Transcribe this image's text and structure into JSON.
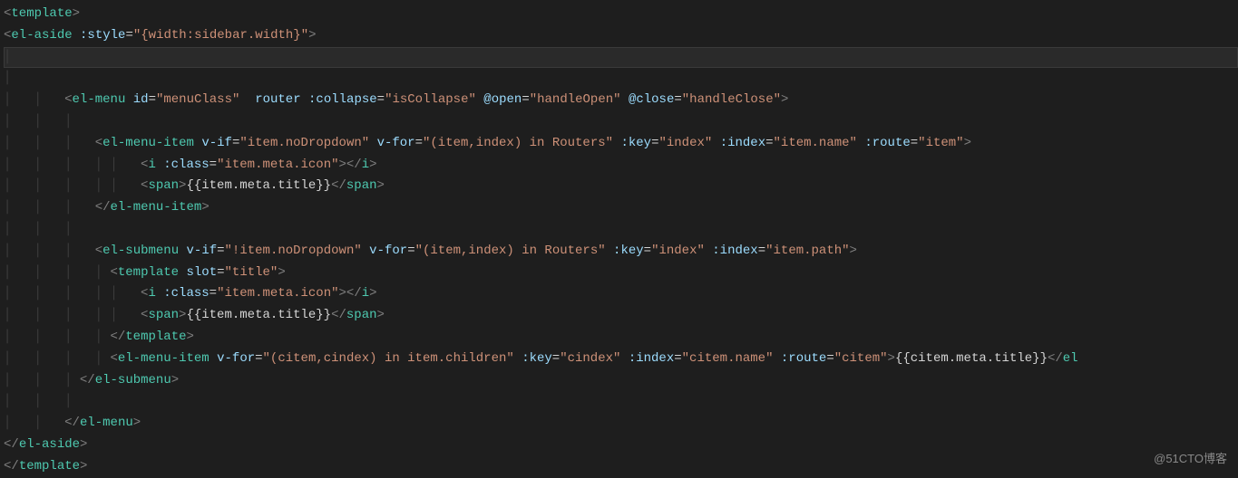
{
  "watermark": "@51CTO博客",
  "code": {
    "lines": [
      {
        "indent": 0,
        "guides": [],
        "tokens": [
          {
            "c": "brk",
            "t": "<"
          },
          {
            "c": "tag",
            "t": "template"
          },
          {
            "c": "brk",
            "t": ">"
          }
        ]
      },
      {
        "indent": 0,
        "guides": [],
        "tokens": [
          {
            "c": "brk",
            "t": "<"
          },
          {
            "c": "tag",
            "t": "el-aside"
          },
          {
            "c": "txt",
            "t": " "
          },
          {
            "c": "attr",
            "t": ":style"
          },
          {
            "c": "txt",
            "t": "="
          },
          {
            "c": "str",
            "t": "\"{width:sidebar.width}\""
          },
          {
            "c": "brk",
            "t": ">"
          }
        ]
      },
      {
        "indent": 0,
        "guides": [
          0
        ],
        "caret": true,
        "tokens": []
      },
      {
        "indent": 0,
        "guides": [
          0
        ],
        "tokens": []
      },
      {
        "indent": 8,
        "guides": [
          0,
          4
        ],
        "tokens": [
          {
            "c": "brk",
            "t": "<"
          },
          {
            "c": "tag",
            "t": "el-menu"
          },
          {
            "c": "txt",
            "t": " "
          },
          {
            "c": "attr",
            "t": "id"
          },
          {
            "c": "txt",
            "t": "="
          },
          {
            "c": "str",
            "t": "\"menuClass\""
          },
          {
            "c": "txt",
            "t": "  "
          },
          {
            "c": "attr",
            "t": "router"
          },
          {
            "c": "txt",
            "t": " "
          },
          {
            "c": "attr",
            "t": ":collapse"
          },
          {
            "c": "txt",
            "t": "="
          },
          {
            "c": "str",
            "t": "\"isCollapse\""
          },
          {
            "c": "txt",
            "t": " "
          },
          {
            "c": "attr",
            "t": "@open"
          },
          {
            "c": "txt",
            "t": "="
          },
          {
            "c": "str",
            "t": "\"handleOpen\""
          },
          {
            "c": "txt",
            "t": " "
          },
          {
            "c": "attr",
            "t": "@close"
          },
          {
            "c": "txt",
            "t": "="
          },
          {
            "c": "str",
            "t": "\"handleClose\""
          },
          {
            "c": "brk",
            "t": ">"
          }
        ]
      },
      {
        "indent": 0,
        "guides": [
          0,
          4,
          8
        ],
        "tokens": []
      },
      {
        "indent": 12,
        "guides": [
          0,
          4,
          8
        ],
        "tokens": [
          {
            "c": "brk",
            "t": "<"
          },
          {
            "c": "tag",
            "t": "el-menu-item"
          },
          {
            "c": "txt",
            "t": " "
          },
          {
            "c": "attr",
            "t": "v-if"
          },
          {
            "c": "txt",
            "t": "="
          },
          {
            "c": "str",
            "t": "\"item.noDropdown\""
          },
          {
            "c": "txt",
            "t": " "
          },
          {
            "c": "attr",
            "t": "v-for"
          },
          {
            "c": "txt",
            "t": "="
          },
          {
            "c": "str",
            "t": "\"(item,index) in Routers\""
          },
          {
            "c": "txt",
            "t": " "
          },
          {
            "c": "attr",
            "t": ":key"
          },
          {
            "c": "txt",
            "t": "="
          },
          {
            "c": "str",
            "t": "\"index\""
          },
          {
            "c": "txt",
            "t": " "
          },
          {
            "c": "attr",
            "t": ":index"
          },
          {
            "c": "txt",
            "t": "="
          },
          {
            "c": "str",
            "t": "\"item.name\""
          },
          {
            "c": "txt",
            "t": " "
          },
          {
            "c": "attr",
            "t": ":route"
          },
          {
            "c": "txt",
            "t": "="
          },
          {
            "c": "str",
            "t": "\"item\""
          },
          {
            "c": "brk",
            "t": ">"
          }
        ]
      },
      {
        "indent": 18,
        "guides": [
          0,
          4,
          8,
          12,
          14
        ],
        "tokens": [
          {
            "c": "brk",
            "t": "<"
          },
          {
            "c": "tag",
            "t": "i"
          },
          {
            "c": "txt",
            "t": " "
          },
          {
            "c": "attr",
            "t": ":class"
          },
          {
            "c": "txt",
            "t": "="
          },
          {
            "c": "str",
            "t": "\"item.meta.icon\""
          },
          {
            "c": "brk",
            "t": "></"
          },
          {
            "c": "tag",
            "t": "i"
          },
          {
            "c": "brk",
            "t": ">"
          }
        ]
      },
      {
        "indent": 18,
        "guides": [
          0,
          4,
          8,
          12,
          14
        ],
        "tokens": [
          {
            "c": "brk",
            "t": "<"
          },
          {
            "c": "tag",
            "t": "span"
          },
          {
            "c": "brk",
            "t": ">"
          },
          {
            "c": "txt",
            "t": "{{item.meta.title}}"
          },
          {
            "c": "brk",
            "t": "</"
          },
          {
            "c": "tag",
            "t": "span"
          },
          {
            "c": "brk",
            "t": ">"
          }
        ]
      },
      {
        "indent": 12,
        "guides": [
          0,
          4,
          8
        ],
        "tokens": [
          {
            "c": "brk",
            "t": "</"
          },
          {
            "c": "tag",
            "t": "el-menu-item"
          },
          {
            "c": "brk",
            "t": ">"
          }
        ]
      },
      {
        "indent": 0,
        "guides": [
          0,
          4,
          8
        ],
        "tokens": []
      },
      {
        "indent": 12,
        "guides": [
          0,
          4,
          8
        ],
        "tokens": [
          {
            "c": "brk",
            "t": "<"
          },
          {
            "c": "tag",
            "t": "el-submenu"
          },
          {
            "c": "txt",
            "t": " "
          },
          {
            "c": "attr",
            "t": "v-if"
          },
          {
            "c": "txt",
            "t": "="
          },
          {
            "c": "str",
            "t": "\"!item.noDropdown\""
          },
          {
            "c": "txt",
            "t": " "
          },
          {
            "c": "attr",
            "t": "v-for"
          },
          {
            "c": "txt",
            "t": "="
          },
          {
            "c": "str",
            "t": "\"(item,index) in Routers\""
          },
          {
            "c": "txt",
            "t": " "
          },
          {
            "c": "attr",
            "t": ":key"
          },
          {
            "c": "txt",
            "t": "="
          },
          {
            "c": "str",
            "t": "\"index\""
          },
          {
            "c": "txt",
            "t": " "
          },
          {
            "c": "attr",
            "t": ":index"
          },
          {
            "c": "txt",
            "t": "="
          },
          {
            "c": "str",
            "t": "\"item.path\""
          },
          {
            "c": "brk",
            "t": ">"
          }
        ]
      },
      {
        "indent": 14,
        "guides": [
          0,
          4,
          8,
          12
        ],
        "tokens": [
          {
            "c": "brk",
            "t": "<"
          },
          {
            "c": "tag",
            "t": "template"
          },
          {
            "c": "txt",
            "t": " "
          },
          {
            "c": "attr",
            "t": "slot"
          },
          {
            "c": "txt",
            "t": "="
          },
          {
            "c": "str",
            "t": "\"title\""
          },
          {
            "c": "brk",
            "t": ">"
          }
        ]
      },
      {
        "indent": 18,
        "guides": [
          0,
          4,
          8,
          12,
          14
        ],
        "tokens": [
          {
            "c": "brk",
            "t": "<"
          },
          {
            "c": "tag",
            "t": "i"
          },
          {
            "c": "txt",
            "t": " "
          },
          {
            "c": "attr",
            "t": ":class"
          },
          {
            "c": "txt",
            "t": "="
          },
          {
            "c": "str",
            "t": "\"item.meta.icon\""
          },
          {
            "c": "brk",
            "t": "></"
          },
          {
            "c": "tag",
            "t": "i"
          },
          {
            "c": "brk",
            "t": ">"
          }
        ]
      },
      {
        "indent": 18,
        "guides": [
          0,
          4,
          8,
          12,
          14
        ],
        "tokens": [
          {
            "c": "brk",
            "t": "<"
          },
          {
            "c": "tag",
            "t": "span"
          },
          {
            "c": "brk",
            "t": ">"
          },
          {
            "c": "txt",
            "t": "{{item.meta.title}}"
          },
          {
            "c": "brk",
            "t": "</"
          },
          {
            "c": "tag",
            "t": "span"
          },
          {
            "c": "brk",
            "t": ">"
          }
        ]
      },
      {
        "indent": 14,
        "guides": [
          0,
          4,
          8,
          12
        ],
        "tokens": [
          {
            "c": "brk",
            "t": "</"
          },
          {
            "c": "tag",
            "t": "template"
          },
          {
            "c": "brk",
            "t": ">"
          }
        ]
      },
      {
        "indent": 14,
        "guides": [
          0,
          4,
          8,
          12
        ],
        "tokens": [
          {
            "c": "brk",
            "t": "<"
          },
          {
            "c": "tag",
            "t": "el-menu-item"
          },
          {
            "c": "txt",
            "t": " "
          },
          {
            "c": "attr",
            "t": "v-for"
          },
          {
            "c": "txt",
            "t": "="
          },
          {
            "c": "str",
            "t": "\"(citem,cindex) in item.children\""
          },
          {
            "c": "txt",
            "t": " "
          },
          {
            "c": "attr",
            "t": ":key"
          },
          {
            "c": "txt",
            "t": "="
          },
          {
            "c": "str",
            "t": "\"cindex\""
          },
          {
            "c": "txt",
            "t": " "
          },
          {
            "c": "attr",
            "t": ":index"
          },
          {
            "c": "txt",
            "t": "="
          },
          {
            "c": "str",
            "t": "\"citem.name\""
          },
          {
            "c": "txt",
            "t": " "
          },
          {
            "c": "attr",
            "t": ":route"
          },
          {
            "c": "txt",
            "t": "="
          },
          {
            "c": "str",
            "t": "\"citem\""
          },
          {
            "c": "brk",
            "t": ">"
          },
          {
            "c": "txt",
            "t": "{{citem.meta.title}}"
          },
          {
            "c": "brk",
            "t": "</"
          },
          {
            "c": "tag",
            "t": "el"
          }
        ]
      },
      {
        "indent": 10,
        "guides": [
          0,
          4,
          8
        ],
        "tokens": [
          {
            "c": "brk",
            "t": "</"
          },
          {
            "c": "tag",
            "t": "el-submenu"
          },
          {
            "c": "brk",
            "t": ">"
          }
        ]
      },
      {
        "indent": 0,
        "guides": [
          0,
          4,
          8
        ],
        "tokens": []
      },
      {
        "indent": 8,
        "guides": [
          0,
          4
        ],
        "tokens": [
          {
            "c": "brk",
            "t": "</"
          },
          {
            "c": "tag",
            "t": "el-menu"
          },
          {
            "c": "brk",
            "t": ">"
          }
        ]
      },
      {
        "indent": 0,
        "guides": [],
        "tokens": [
          {
            "c": "brk",
            "t": "</"
          },
          {
            "c": "tag",
            "t": "el-aside"
          },
          {
            "c": "brk",
            "t": ">"
          }
        ]
      },
      {
        "indent": 0,
        "guides": [],
        "tokens": [
          {
            "c": "brk",
            "t": "</"
          },
          {
            "c": "tag",
            "t": "template"
          },
          {
            "c": "brk",
            "t": ">"
          }
        ]
      }
    ]
  }
}
